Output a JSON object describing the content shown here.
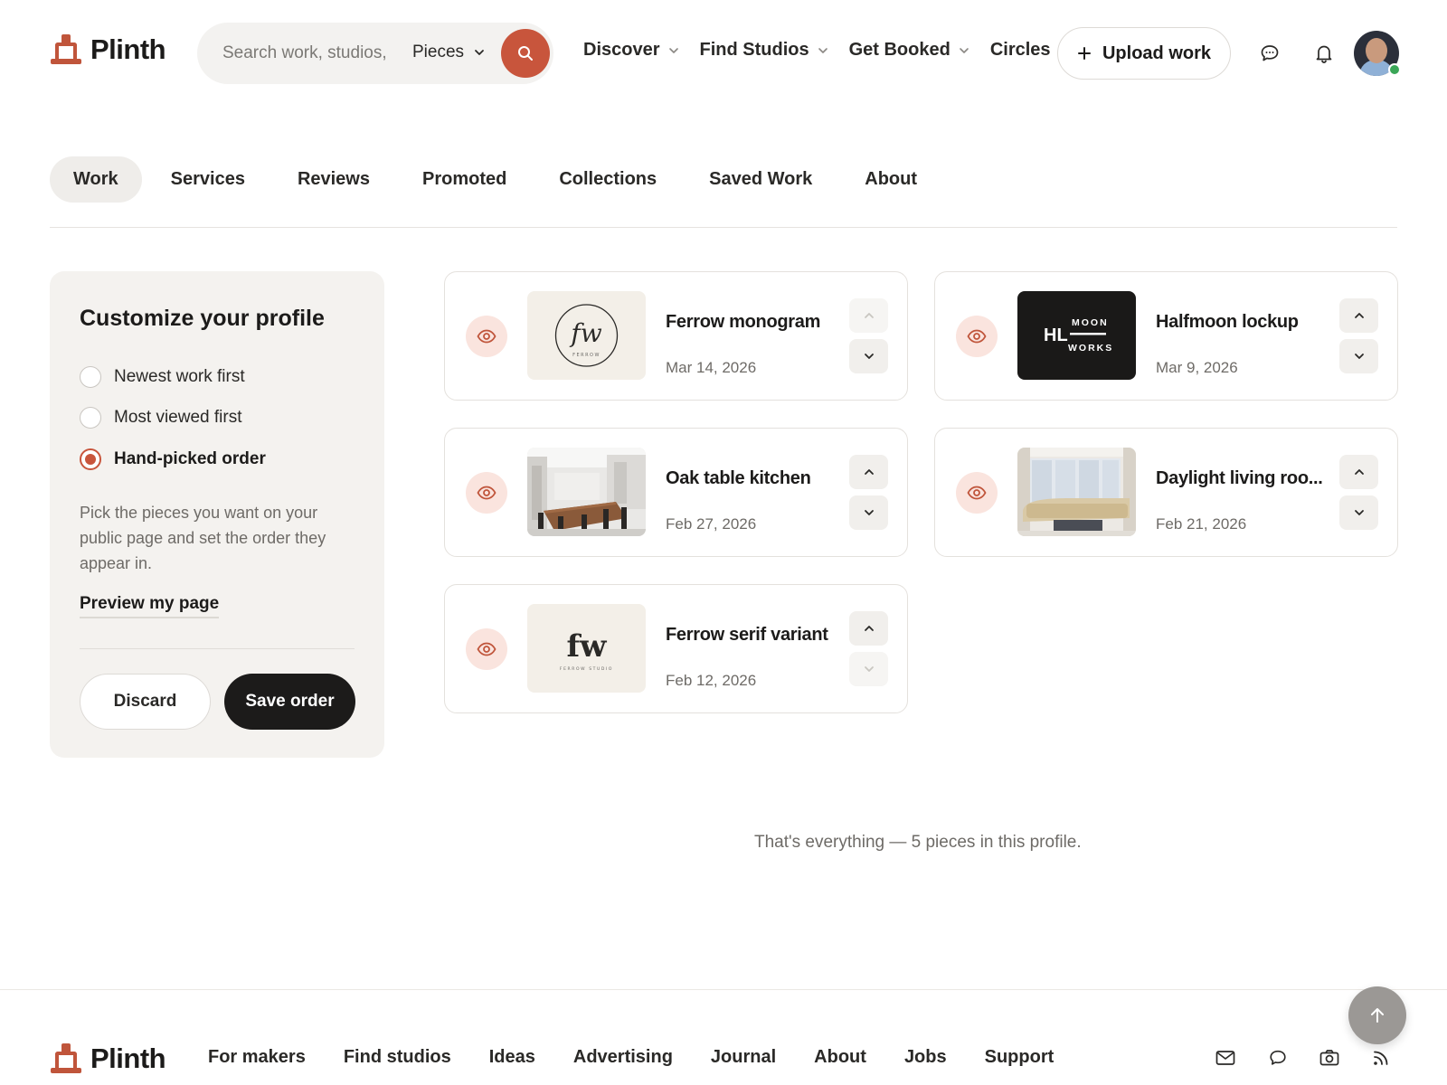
{
  "brand": {
    "name": "Plinth",
    "accent": "#c8553c"
  },
  "header": {
    "search": {
      "placeholder": "Search work, studios, ",
      "scope": "Pieces"
    },
    "nav": [
      {
        "label": "Discover"
      },
      {
        "label": "Find Studios"
      },
      {
        "label": "Get Booked"
      },
      {
        "label": "Circles"
      }
    ],
    "upload_label": "Upload work",
    "icons": [
      "chat-icon",
      "bell-icon"
    ],
    "avatar_status": "online"
  },
  "tabs": [
    {
      "label": "Work",
      "active": true
    },
    {
      "label": "Services"
    },
    {
      "label": "Reviews"
    },
    {
      "label": "Promoted"
    },
    {
      "label": "Collections"
    },
    {
      "label": "Saved Work"
    },
    {
      "label": "About"
    }
  ],
  "sidebar": {
    "title": "Customize your profile",
    "options": [
      {
        "label": "Newest work first",
        "selected": false
      },
      {
        "label": "Most viewed first",
        "selected": false
      },
      {
        "label": "Hand-picked order",
        "selected": true
      }
    ],
    "help": "Pick the pieces you want on your public page and set the order they appear in.",
    "preview_link": "Preview my page",
    "discard_label": "Discard",
    "save_label": "Save order"
  },
  "works": [
    {
      "title": "Ferrow monogram",
      "date": "Mar 14, 2026",
      "thumb_text": "fw",
      "thumb_sub": "FERROW"
    },
    {
      "title": "Halfmoon lockup",
      "date": "Mar 9, 2026",
      "thumb_text": "HL",
      "thumb_sub": "MOON",
      "thumb_sub2": "WORKS"
    },
    {
      "title": "Oak table kitchen",
      "date": "Feb 27, 2026"
    },
    {
      "title": "Daylight living roo...",
      "date": "Feb 21, 2026"
    },
    {
      "title": "Ferrow serif variant",
      "date": "Feb 12, 2026",
      "thumb_text": "fw",
      "thumb_sub": "FERROW STUDIO"
    }
  ],
  "end_note": "That's everything — 5 pieces in this profile.",
  "footer": {
    "links": [
      {
        "label": "For makers"
      },
      {
        "label": "Find studios"
      },
      {
        "label": "Ideas"
      },
      {
        "label": "Advertising"
      },
      {
        "label": "Journal"
      },
      {
        "label": "About"
      },
      {
        "label": "Jobs"
      },
      {
        "label": "Support"
      }
    ],
    "icons": [
      "mail-icon",
      "chat-icon",
      "camera-icon",
      "rss-icon"
    ]
  }
}
